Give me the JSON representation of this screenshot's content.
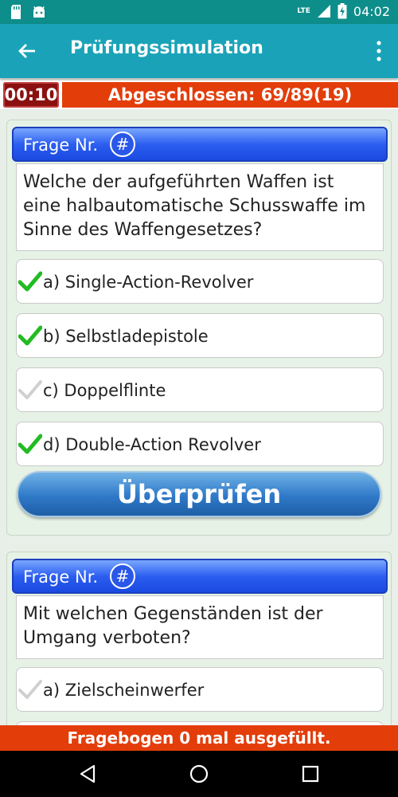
{
  "status_bar": {
    "time": "04:02",
    "network": "LTE"
  },
  "app_bar": {
    "title": "Prüfungssimulation"
  },
  "exam": {
    "timer": "00:10",
    "progress": "Abgeschlossen: 69/89(19)"
  },
  "questions": [
    {
      "header_label": "Frage Nr.",
      "number_badge": "#",
      "text": "Welche der aufgeführten Waffen ist eine halbautomatische Schusswaffe im Sinne des Waffengesetzes?",
      "answers": [
        {
          "label": "a) Single-Action-Revolver",
          "checked": true
        },
        {
          "label": "b) Selbstladepistole",
          "checked": true
        },
        {
          "label": "c) Doppelflinte",
          "checked": false
        },
        {
          "label": "d) Double-Action Revolver",
          "checked": true
        }
      ],
      "check_button": "Überprüfen"
    },
    {
      "header_label": "Frage Nr.",
      "number_badge": "#",
      "text": "Mit welchen Gegenständen ist der Umgang verboten?",
      "answers": [
        {
          "label": "a) Zielscheinwerfer",
          "checked": false
        }
      ]
    }
  ],
  "footer": {
    "text": "Fragebogen 0 mal ausgefüllt."
  },
  "colors": {
    "check_on": "#22bb22",
    "check_off": "#d0d0d0",
    "app_bar": "#1aa3b8",
    "status_bar": "#0e8e8b",
    "accent_orange": "#e33d0a"
  }
}
